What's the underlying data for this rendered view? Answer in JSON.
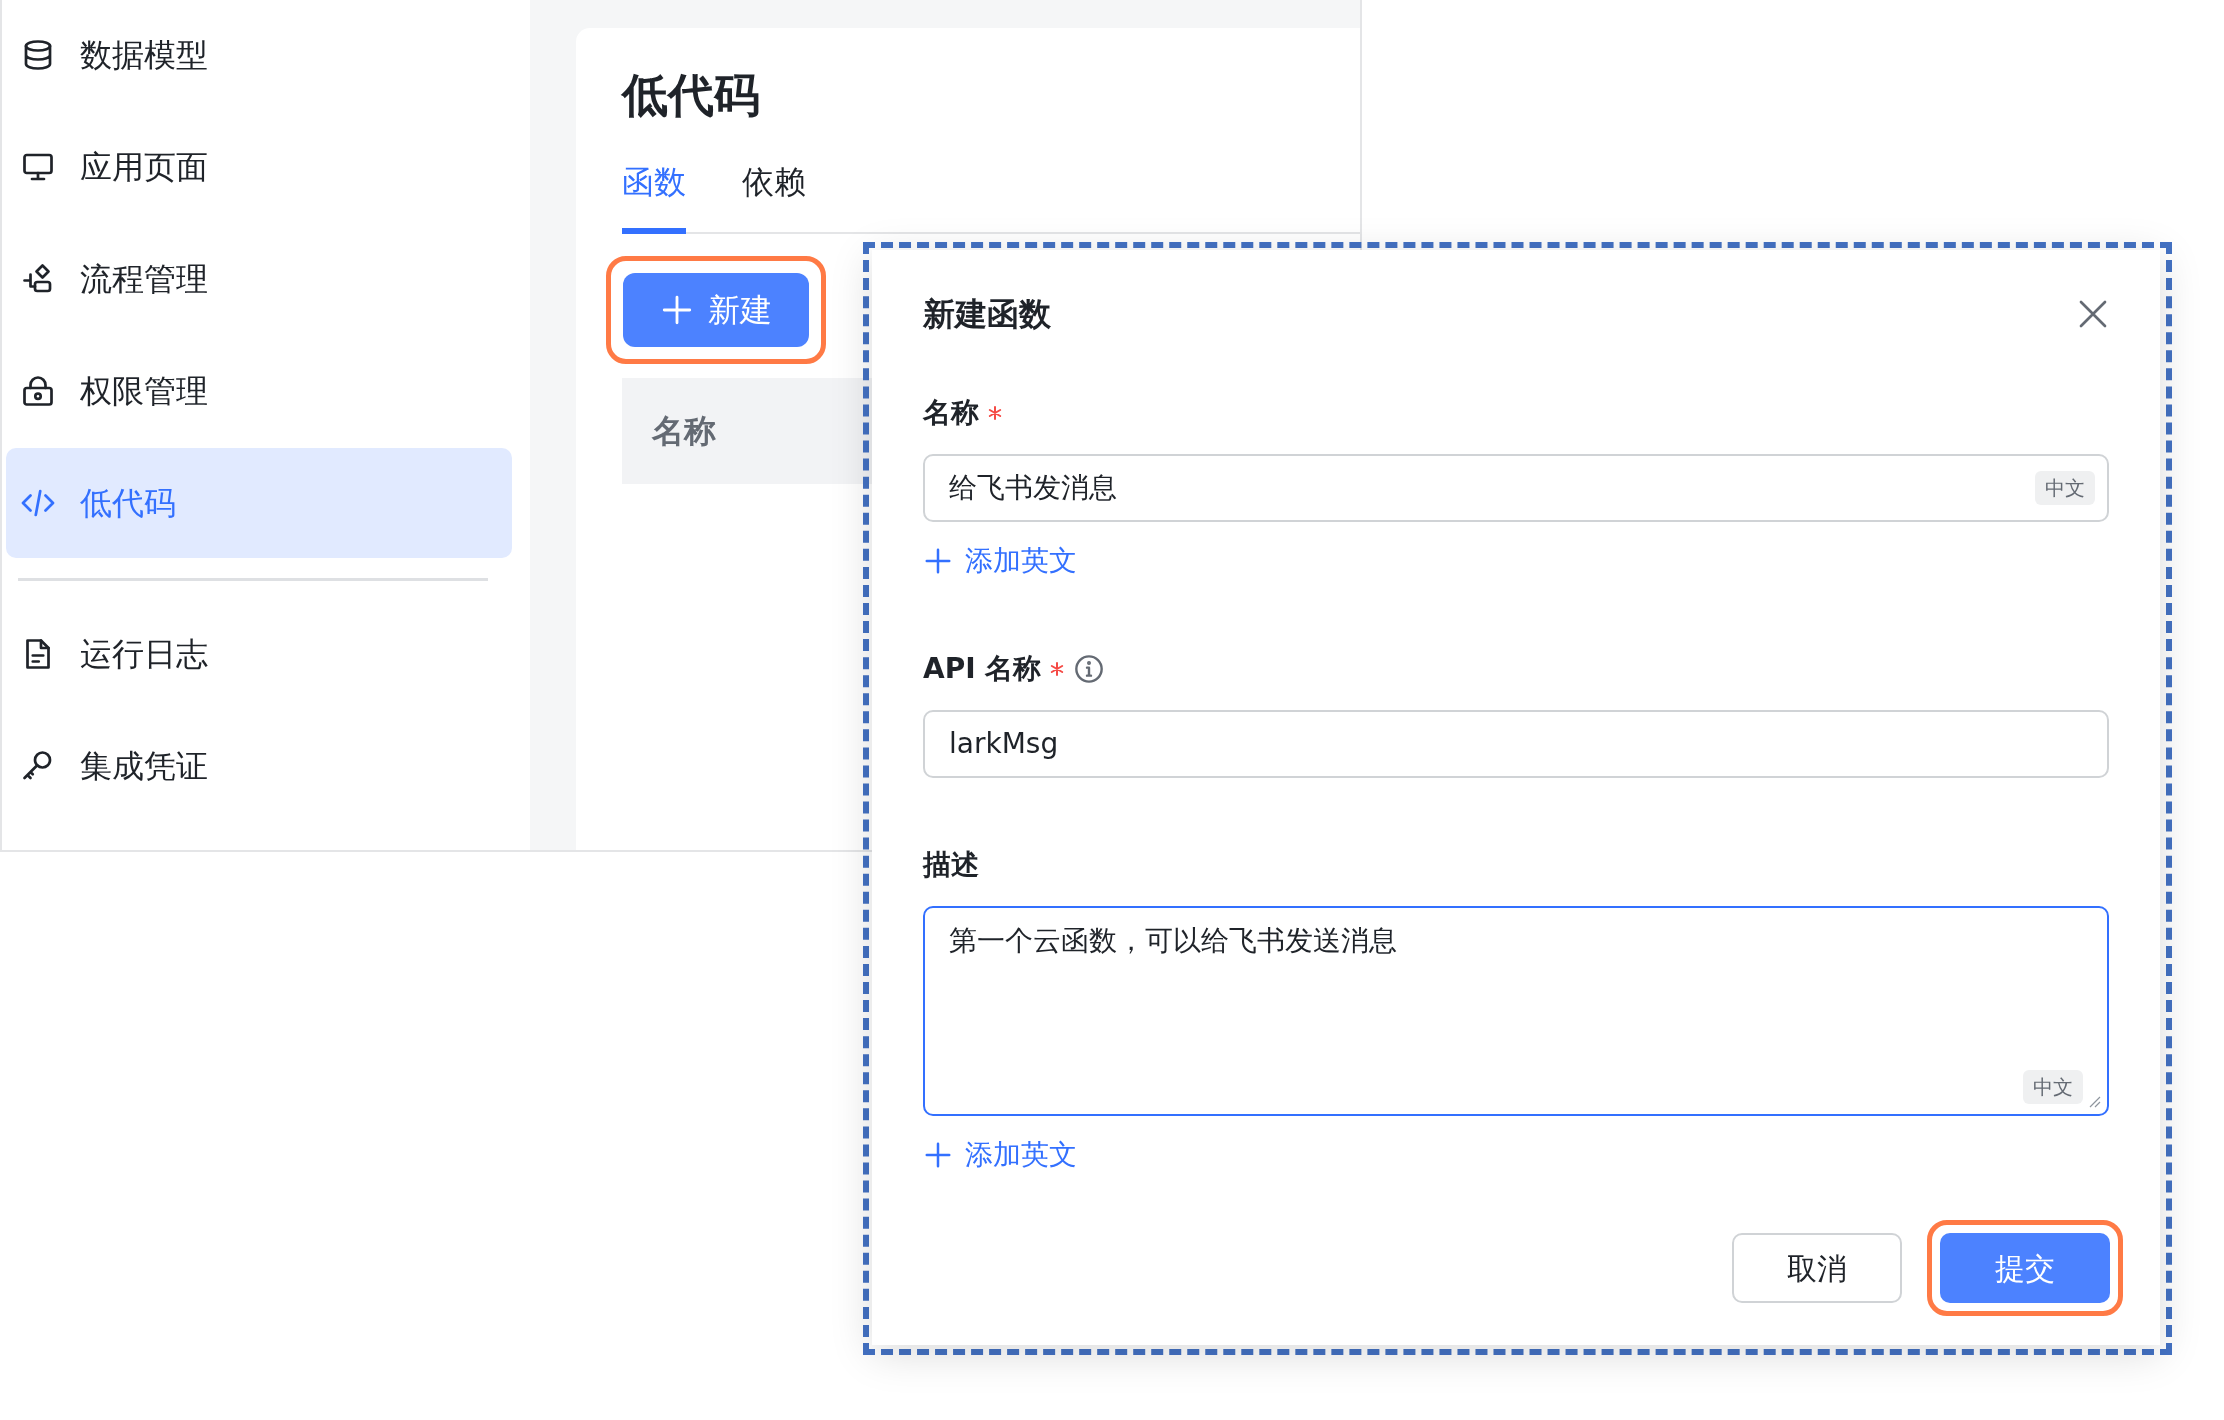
{
  "sidebar": {
    "items": [
      {
        "label": "数据模型",
        "selected": false
      },
      {
        "label": "应用页面",
        "selected": false
      },
      {
        "label": "流程管理",
        "selected": false
      },
      {
        "label": "权限管理",
        "selected": false
      },
      {
        "label": "低代码",
        "selected": true
      },
      {
        "kind": "divider"
      },
      {
        "label": "运行日志",
        "selected": false
      },
      {
        "label": "集成凭证",
        "selected": false
      }
    ]
  },
  "page": {
    "title": "低代码",
    "tabs": [
      {
        "label": "函数",
        "selected": true
      },
      {
        "label": "依赖",
        "selected": false
      }
    ],
    "new_button": {
      "label": "新建",
      "highlighted": true
    },
    "table": {
      "columns": [
        "名称"
      ]
    }
  },
  "dialog": {
    "title": "新建函数",
    "highlighted": true,
    "fields": [
      {
        "kind": "input",
        "label": "名称",
        "required": true,
        "info": false,
        "value": "给飞书发消息",
        "lang_tag": "中文",
        "add_link": "添加英文",
        "focused": false
      },
      {
        "kind": "input",
        "label": "API 名称",
        "required": true,
        "info": true,
        "value": "larkMsg",
        "focused": false
      },
      {
        "kind": "textarea",
        "label": "描述",
        "required": false,
        "info": false,
        "value": "第一个云函数，可以给飞书发送消息",
        "lang_tag": "中文",
        "add_link": "添加英文",
        "focused": true
      }
    ],
    "buttons": [
      {
        "label": "取消",
        "kind": "secondary",
        "highlighted": false
      },
      {
        "label": "提交",
        "kind": "primary",
        "highlighted": true
      }
    ]
  }
}
